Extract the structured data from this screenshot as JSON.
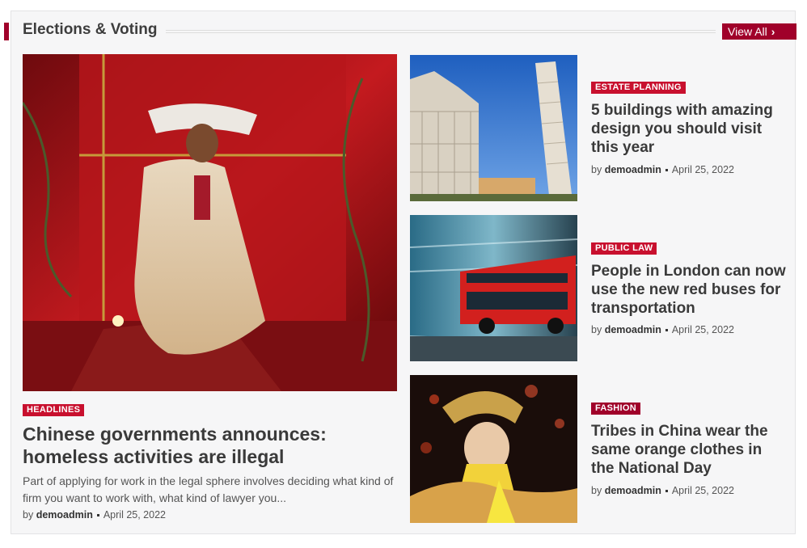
{
  "section": {
    "title": "Elections & Voting",
    "view_all": "View All",
    "view_all_icon": "chevron-right-icon",
    "accent_color": "#a0002a"
  },
  "featured": {
    "image": "woman-in-red-room-photo",
    "tag": "HEADLINES",
    "title": "Chinese governments announces: homeless activities are illegal",
    "excerpt": "Part of applying for work in the legal sphere involves deciding what kind of firm you want to work with, what kind of lawyer you...",
    "by": "by",
    "author": "demoadmin",
    "date": "April 25, 2022"
  },
  "articles": [
    {
      "image": "leaning-tower-pisa-photo",
      "tag": "ESTATE PLANNING",
      "title": "5 buildings with amazing design you should visit this year",
      "by": "by",
      "author": "demoadmin",
      "date": "April 25, 2022"
    },
    {
      "image": "red-bus-motion-photo",
      "tag": "PUBLIC LAW",
      "title": "People in London can now use the new red buses for transportation",
      "by": "by",
      "author": "demoadmin",
      "date": "April 25, 2022"
    },
    {
      "image": "chinese-costume-photo",
      "tag": "FASHION",
      "title": "Tribes in China wear the same orange clothes in the National Day",
      "by": "by",
      "author": "demoadmin",
      "date": "April 25, 2022"
    }
  ],
  "colors": {
    "tag_red": "#c8102e",
    "tag_dark": "#a0002a"
  }
}
